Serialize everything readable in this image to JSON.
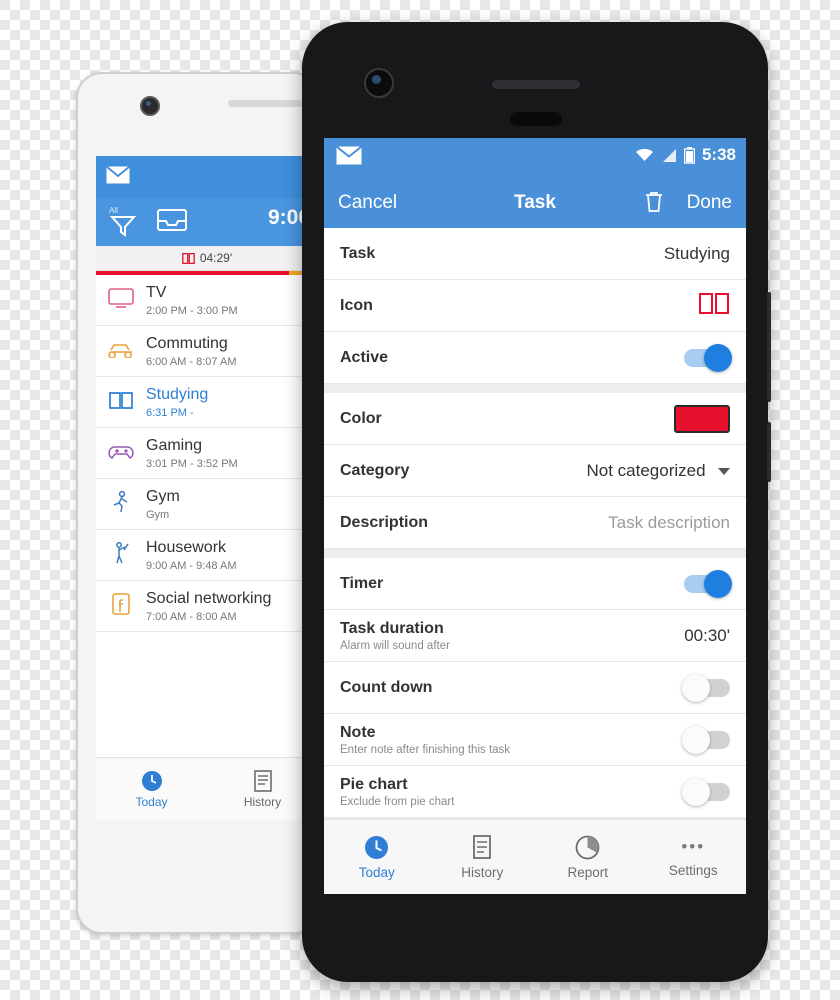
{
  "back_phone": {
    "status": {
      "mail_icon": "mail-icon"
    },
    "appbar": {
      "filter_icon": "filter-icon",
      "filter_label": "All",
      "archive_icon": "archive-icon",
      "time": "9:00"
    },
    "timer_bar": {
      "icon": "book-icon",
      "value": "04:29'"
    },
    "tasks": [
      {
        "icon": "tv-icon",
        "name": "TV",
        "time": "2:00 PM - 3:00 PM",
        "selected": false
      },
      {
        "icon": "car-icon",
        "name": "Commuting",
        "time": "6:00 AM - 8:07 AM",
        "selected": false
      },
      {
        "icon": "book-icon",
        "name": "Studying",
        "time": "6:31 PM -",
        "selected": true
      },
      {
        "icon": "gamepad-icon",
        "name": "Gaming",
        "time": "3:01 PM - 3:52 PM",
        "selected": false
      },
      {
        "icon": "gym-icon",
        "name": "Gym",
        "time": "Gym",
        "selected": false
      },
      {
        "icon": "housework-icon",
        "name": "Housework",
        "time": "9:00 AM - 9:48 AM",
        "selected": false
      },
      {
        "icon": "facebook-icon",
        "name": "Social networking",
        "time": "7:00 AM - 8:00 AM",
        "selected": false
      }
    ],
    "nav": [
      {
        "icon": "clock-icon",
        "label": "Today",
        "active": true
      },
      {
        "icon": "list-icon",
        "label": "History",
        "active": false
      }
    ]
  },
  "front_phone": {
    "status": {
      "mail_icon": "mail-icon",
      "wifi_icon": "wifi-icon",
      "signal_icon": "signal-icon",
      "battery_icon": "battery-icon",
      "clock": "5:38"
    },
    "appbar": {
      "cancel": "Cancel",
      "title": "Task",
      "delete_icon": "trash-icon",
      "done": "Done"
    },
    "fields": {
      "task_label": "Task",
      "task_value": "Studying",
      "icon_label": "Icon",
      "icon_value": "book-icon",
      "active_label": "Active",
      "active_on": true,
      "color_label": "Color",
      "color_value": "#e8112d",
      "category_label": "Category",
      "category_value": "Not categorized",
      "description_label": "Description",
      "description_placeholder": "Task description",
      "timer_label": "Timer",
      "timer_on": true,
      "duration_label": "Task duration",
      "duration_sub": "Alarm will sound after",
      "duration_value": "00:30'",
      "countdown_label": "Count down",
      "countdown_on": false,
      "note_label": "Note",
      "note_sub": "Enter note after finishing this task",
      "note_on": false,
      "pie_label": "Pie chart",
      "pie_sub": "Exclude from pie chart",
      "pie_on": false
    },
    "nav": [
      {
        "icon": "clock-icon",
        "label": "Today",
        "active": true
      },
      {
        "icon": "list-icon",
        "label": "History",
        "active": false
      },
      {
        "icon": "pie-icon",
        "label": "Report",
        "active": false
      },
      {
        "icon": "overflow-icon",
        "label": "Settings",
        "active": false
      }
    ]
  }
}
